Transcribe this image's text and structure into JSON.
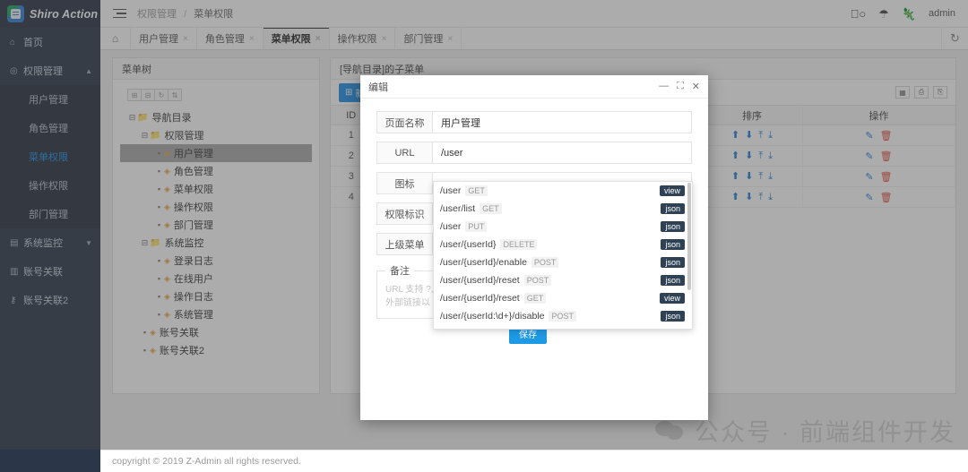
{
  "app": {
    "title": "Shiro Action",
    "logo_icon": "shield-id-icon"
  },
  "sidebar": {
    "items": [
      {
        "label": "首页",
        "icon": "home-icon",
        "type": "item"
      },
      {
        "label": "权限管理",
        "icon": "shield-icon",
        "type": "group",
        "arrow": "▲",
        "expanded": true,
        "children": [
          {
            "label": "用户管理",
            "active": false
          },
          {
            "label": "角色管理",
            "active": false
          },
          {
            "label": "菜单权限",
            "active": true
          },
          {
            "label": "操作权限",
            "active": false
          },
          {
            "label": "部门管理",
            "active": false
          }
        ]
      },
      {
        "label": "系统监控",
        "icon": "monitor-icon",
        "type": "group",
        "arrow": "▼",
        "expanded": false
      },
      {
        "label": "账号关联",
        "icon": "table-icon",
        "type": "item"
      },
      {
        "label": "账号关联2",
        "icon": "branch-icon",
        "type": "item"
      }
    ]
  },
  "header": {
    "menu_icon": "hamburger-icon",
    "breadcrumb_root": "权限管理",
    "breadcrumb_sep": "/",
    "breadcrumb_current": "菜单权限",
    "github_icon": "github-icon",
    "gift_icon": "gift-icon",
    "dino_icon": "dinosaur-icon",
    "username": "admin"
  },
  "tabs": {
    "home_icon": "home-outline-icon",
    "refresh_icon": "↻",
    "items": [
      {
        "label": "用户管理",
        "active": false,
        "close": "×"
      },
      {
        "label": "角色管理",
        "active": false,
        "close": "×"
      },
      {
        "label": "菜单权限",
        "active": true,
        "close": "×"
      },
      {
        "label": "操作权限",
        "active": false,
        "close": "×"
      },
      {
        "label": "部门管理",
        "active": false,
        "close": "×"
      }
    ]
  },
  "tree_panel": {
    "title": "菜单树",
    "tools": [
      {
        "icon": "expand-all-icon"
      },
      {
        "icon": "collapse-all-icon"
      },
      {
        "icon": "refresh-icon"
      },
      {
        "icon": "sort-icon"
      }
    ],
    "nodes": [
      {
        "label": "导航目录",
        "level": 1,
        "type": "folder",
        "switch": "⊟",
        "selected": false
      },
      {
        "label": "权限管理",
        "level": 2,
        "type": "folder",
        "switch": "⊟",
        "selected": false
      },
      {
        "label": "用户管理",
        "level": 3,
        "type": "leaf",
        "switch": "▪",
        "selected": true
      },
      {
        "label": "角色管理",
        "level": 3,
        "type": "leaf",
        "switch": "▪",
        "selected": false
      },
      {
        "label": "菜单权限",
        "level": 3,
        "type": "leaf",
        "switch": "▪",
        "selected": false
      },
      {
        "label": "操作权限",
        "level": 3,
        "type": "leaf",
        "switch": "▪",
        "selected": false
      },
      {
        "label": "部门管理",
        "level": 3,
        "type": "leaf",
        "switch": "▪",
        "selected": false
      },
      {
        "label": "系统监控",
        "level": 2,
        "type": "folder",
        "switch": "⊟",
        "selected": false
      },
      {
        "label": "登录日志",
        "level": 3,
        "type": "leaf",
        "switch": "▪",
        "selected": false
      },
      {
        "label": "在线用户",
        "level": 3,
        "type": "leaf",
        "switch": "▪",
        "selected": false
      },
      {
        "label": "操作日志",
        "level": 3,
        "type": "leaf",
        "switch": "▪",
        "selected": false
      },
      {
        "label": "系统管理",
        "level": 3,
        "type": "leaf",
        "switch": "▪",
        "selected": false
      },
      {
        "label": "账号关联",
        "level": 2,
        "type": "leaf",
        "switch": "▪",
        "selected": false
      },
      {
        "label": "账号关联2",
        "level": 2,
        "type": "leaf",
        "switch": "▪",
        "selected": false
      }
    ]
  },
  "list_panel": {
    "title": "[导航目录]的子菜单",
    "add_label": "新增",
    "add_icon": "plus-square-icon",
    "tool_icons": [
      {
        "icon": "columns-icon"
      },
      {
        "icon": "export-icon"
      },
      {
        "icon": "print-icon"
      }
    ],
    "columns": [
      "ID",
      "排序",
      "操作"
    ],
    "rows": [
      {
        "id": "1"
      },
      {
        "id": "2"
      },
      {
        "id": "3"
      },
      {
        "id": "4"
      }
    ],
    "sort_icons": [
      "⬆",
      "⬇",
      "⤒",
      "⤓"
    ],
    "op_edit_icon": "edit-icon",
    "op_delete_icon": "trash-icon"
  },
  "modal": {
    "title": "编辑",
    "minimize_icon": "—",
    "maximize_icon": "⛶",
    "close_icon": "✕",
    "fields": [
      {
        "label": "页面名称",
        "value": "用户管理",
        "placeholder": ""
      },
      {
        "label": "URL",
        "value": "/user",
        "placeholder": ""
      },
      {
        "label": "图标",
        "value": "",
        "placeholder": ""
      },
      {
        "label": "权限标识",
        "value": "",
        "placeholder": ""
      },
      {
        "label": "上级菜单",
        "value": "",
        "placeholder": ""
      }
    ],
    "remark_legend": "备注",
    "remark_placeholder": "URL 支持 ?, *,\n外部链接以 htt",
    "save_label": "保存"
  },
  "autocomplete": {
    "items": [
      {
        "path": "/user",
        "method": "GET",
        "tag": "view"
      },
      {
        "path": "/user/list",
        "method": "GET",
        "tag": "json"
      },
      {
        "path": "/user",
        "method": "PUT",
        "tag": "json"
      },
      {
        "path": "/user/{userId}",
        "method": "DELETE",
        "tag": "json"
      },
      {
        "path": "/user/{userId}/enable",
        "method": "POST",
        "tag": "json"
      },
      {
        "path": "/user/{userId}/reset",
        "method": "POST",
        "tag": "json"
      },
      {
        "path": "/user/{userId}/reset",
        "method": "GET",
        "tag": "view"
      },
      {
        "path": "/user/{userId:\\d+}/disable",
        "method": "POST",
        "tag": "json"
      }
    ]
  },
  "footer": {
    "copyright": "copyright © 2019 Z-Admin all rights reserved."
  },
  "watermark": {
    "text": "公众号 · 前端组件开发",
    "icon": "wechat-icon"
  },
  "colors": {
    "accent": "#1e8fe8",
    "sidebar": "#2b3648",
    "danger": "#e24a3a",
    "tag": "#2f4255"
  }
}
